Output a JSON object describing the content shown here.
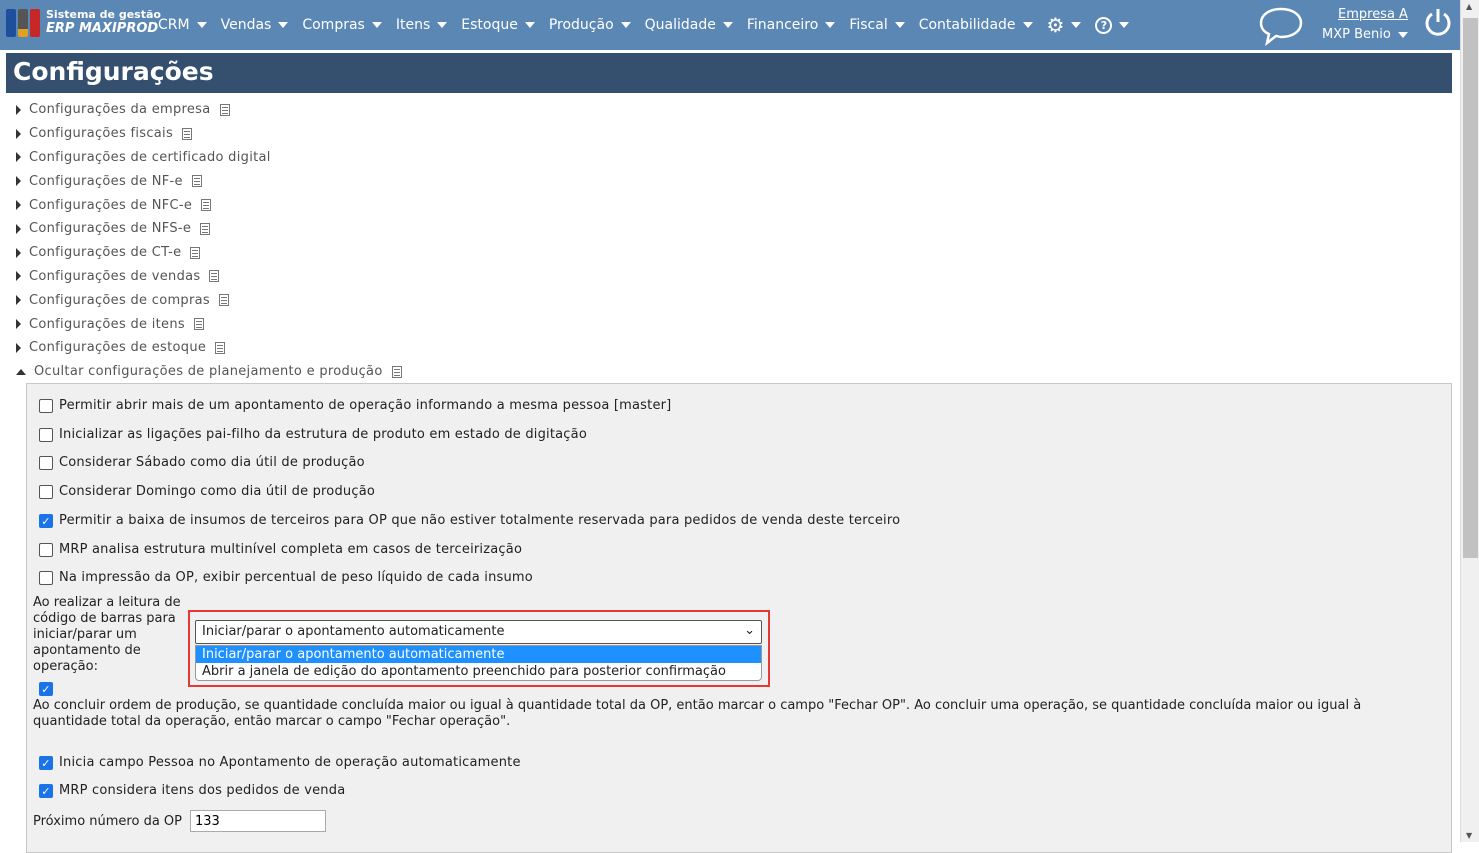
{
  "header": {
    "logo_line1": "Sistema de gestão",
    "logo_line2": "ERP MAXIPROD",
    "menu": [
      "CRM",
      "Vendas",
      "Compras",
      "Itens",
      "Estoque",
      "Produção",
      "Qualidade",
      "Financeiro",
      "Fiscal",
      "Contabilidade"
    ],
    "company": "Empresa A",
    "user": "MXP Benio"
  },
  "page": {
    "title": "Configurações"
  },
  "tree": [
    "Configurações da empresa",
    "Configurações fiscais",
    "Configurações de certificado digital",
    "Configurações de NF-e",
    "Configurações de NFC-e",
    "Configurações de NFS-e",
    "Configurações de CT-e",
    "Configurações de vendas",
    "Configurações de compras",
    "Configurações de itens",
    "Configurações de estoque",
    "Ocultar configurações de planejamento e produção"
  ],
  "settings": {
    "checkboxes": [
      {
        "label": "Permitir abrir mais de um apontamento de operação informando a mesma pessoa [master]",
        "checked": false
      },
      {
        "label": "Inicializar as ligações pai-filho da estrutura de produto em estado de digitação",
        "checked": false
      },
      {
        "label": "Considerar Sábado como dia útil de produção",
        "checked": false
      },
      {
        "label": "Considerar Domingo como dia útil de produção",
        "checked": false
      },
      {
        "label": "Permitir a baixa de insumos de terceiros para OP que não estiver totalmente reservada para pedidos de venda deste terceiro",
        "checked": true
      },
      {
        "label": "MRP analisa estrutura multinível completa em casos de terceirização",
        "checked": false
      },
      {
        "label": "Na impressão da OP, exibir percentual de peso líquido de cada insumo",
        "checked": false
      }
    ],
    "barcode_label": "Ao realizar a leitura de código de barras para iniciar/parar um apontamento de operação:",
    "barcode_value": "Iniciar/parar o apontamento automaticamente",
    "barcode_options": [
      "Iniciar/parar o apontamento automaticamente",
      "Abrir a janela de edição do apontamento preenchido para posterior confirmação"
    ],
    "close_op_text": "Ao concluir ordem de produção, se quantidade concluída maior ou igual à quantidade total da OP, então marcar o campo \"Fechar OP\". Ao concluir uma operação, se quantidade concluída maior ou igual à quantidade total da operação, então marcar o campo \"Fechar operação\".",
    "close_op_checked": true,
    "pessoa_label": "Inicia campo Pessoa no Apontamento de operação automaticamente",
    "mrp_label": "MRP considera itens dos pedidos de venda",
    "next_op_label": "Próximo número da OP",
    "next_op_value": "133"
  }
}
